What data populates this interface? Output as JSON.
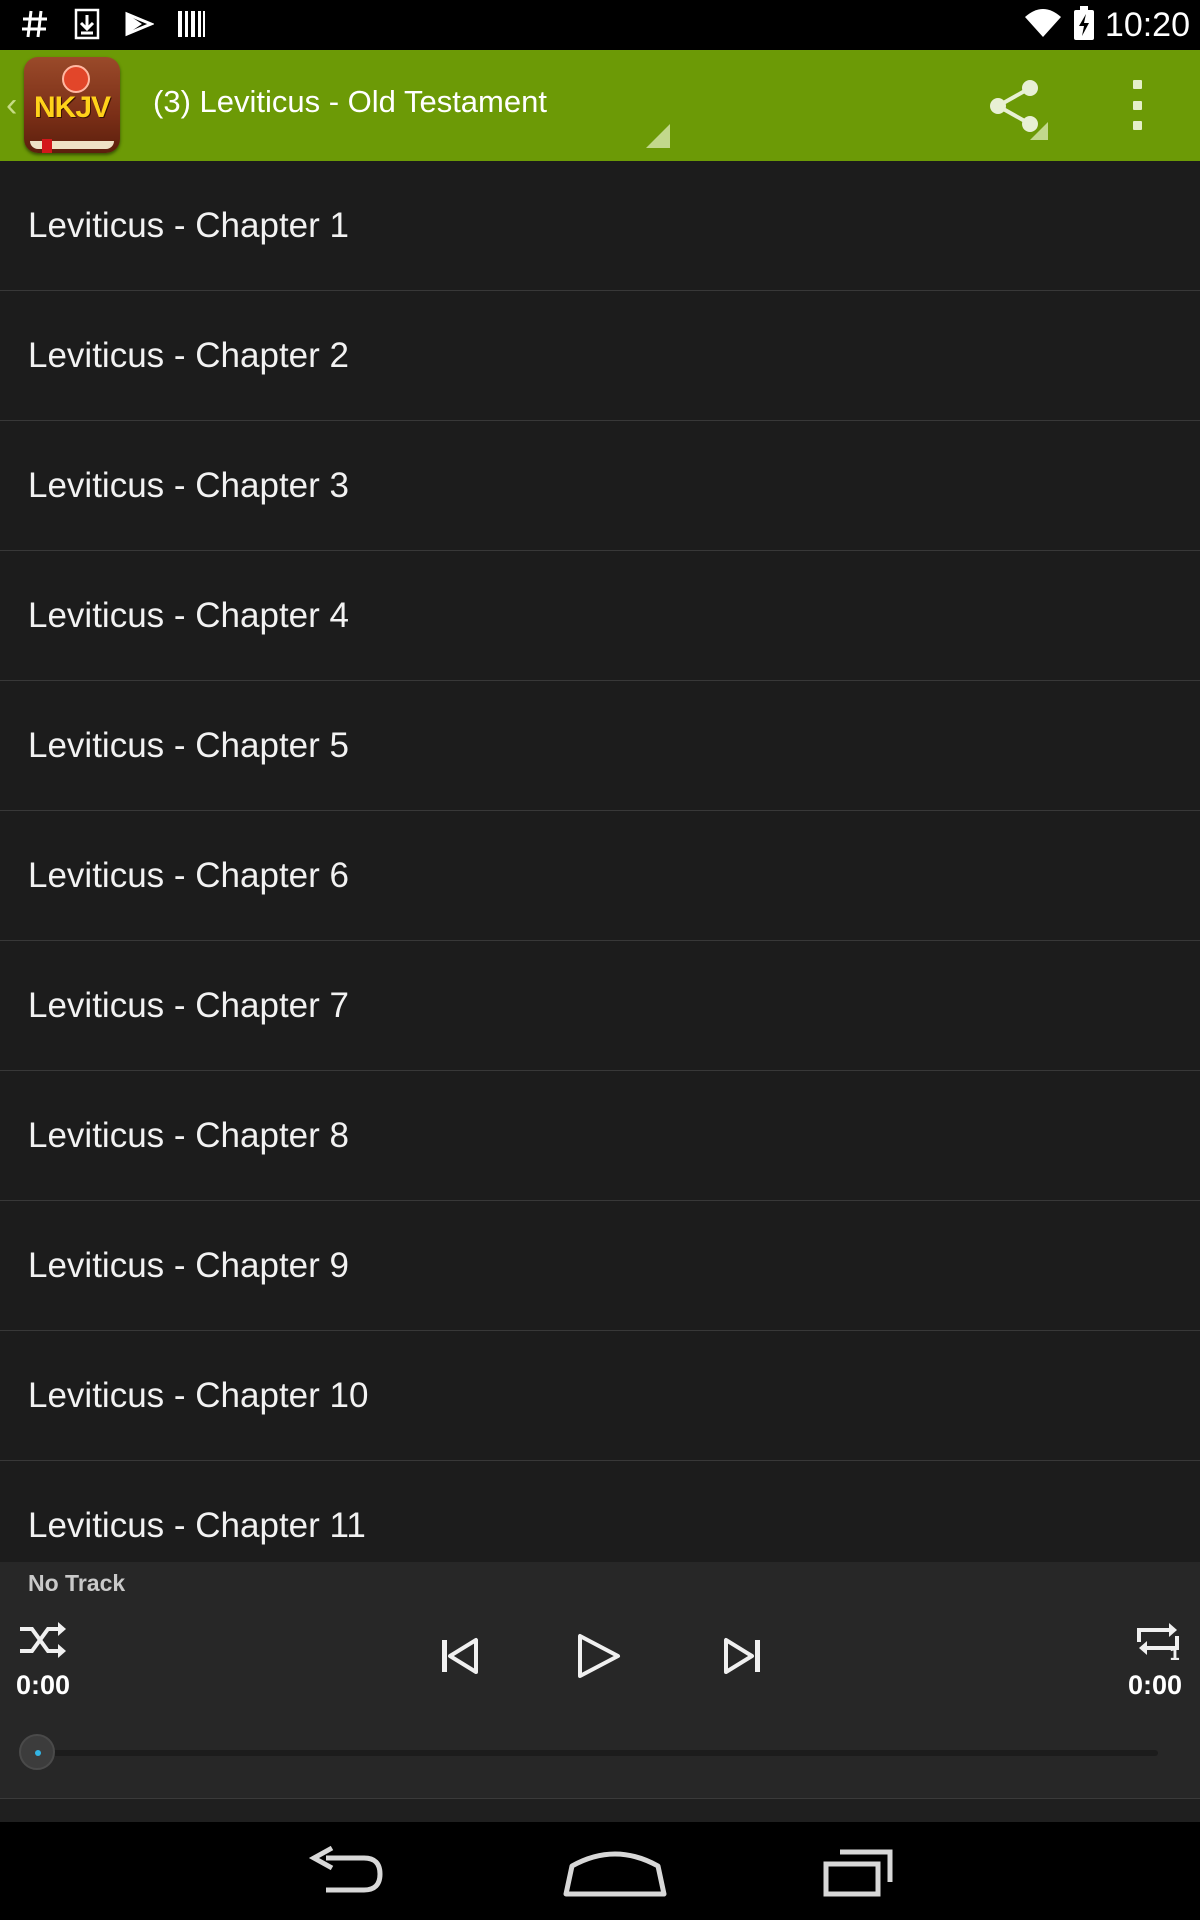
{
  "status_bar": {
    "time": "10:20",
    "left_icons": [
      "hash-icon",
      "download-icon",
      "play-store-icon",
      "barcode-icon"
    ],
    "right_icons": [
      "wifi-icon",
      "battery-charging-icon"
    ]
  },
  "action_bar": {
    "app_logo_text": "NKJV",
    "title": "(3) Leviticus - Old Testament",
    "background_color": "#6c9a06"
  },
  "chapters": [
    {
      "label": "Leviticus - Chapter 1"
    },
    {
      "label": "Leviticus - Chapter 2"
    },
    {
      "label": "Leviticus - Chapter 3"
    },
    {
      "label": "Leviticus - Chapter 4"
    },
    {
      "label": "Leviticus - Chapter 5"
    },
    {
      "label": "Leviticus - Chapter 6"
    },
    {
      "label": "Leviticus - Chapter 7"
    },
    {
      "label": "Leviticus - Chapter 8"
    },
    {
      "label": "Leviticus - Chapter 9"
    },
    {
      "label": "Leviticus - Chapter 10"
    },
    {
      "label": "Leviticus - Chapter 11"
    }
  ],
  "player": {
    "track_title": "No Track",
    "elapsed": "0:00",
    "duration": "0:00",
    "progress": 0
  },
  "colors": {
    "accent": "#33b5e5",
    "list_background": "#1c1c1c"
  }
}
